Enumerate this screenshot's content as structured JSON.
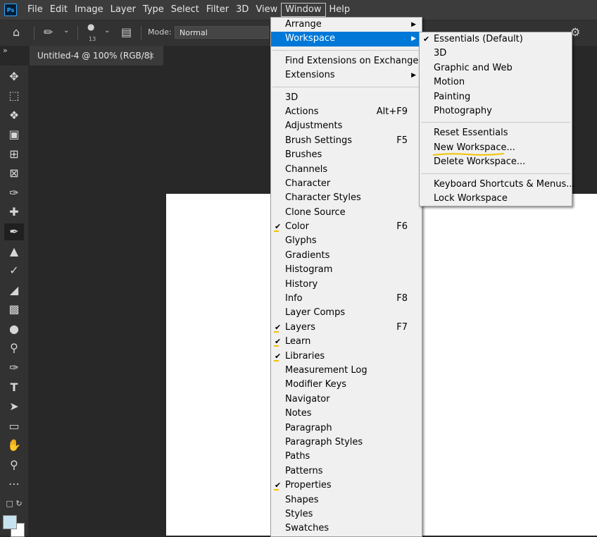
{
  "menubar": {
    "logo": "Ps",
    "items": [
      "File",
      "Edit",
      "Image",
      "Layer",
      "Type",
      "Select",
      "Filter",
      "3D",
      "View",
      "Window",
      "Help"
    ],
    "active": "Window"
  },
  "optbar": {
    "brush_size": "13",
    "mode_label": "Mode:",
    "mode_value": "Normal"
  },
  "tab": {
    "collapse_glyph": "»",
    "title": "Untitled-4 @ 100% (RGB/8)",
    "close": "×"
  },
  "colors": {
    "accent": "#0078d7",
    "menu_bg": "#f0f0f0",
    "annotation": "#f2c200",
    "foreground": "#c8e3f0",
    "background": "#ffffff"
  },
  "window_menu": {
    "items": [
      {
        "label": "Arrange",
        "submenu": true
      },
      {
        "label": "Workspace",
        "submenu": true,
        "highlighted": true
      },
      {
        "divider": true
      },
      {
        "label": "Find Extensions on Exchange..."
      },
      {
        "label": "Extensions",
        "submenu": true
      },
      {
        "divider": true
      },
      {
        "label": "3D"
      },
      {
        "label": "Actions",
        "shortcut": "Alt+F9"
      },
      {
        "label": "Adjustments"
      },
      {
        "label": "Brush Settings",
        "shortcut": "F5"
      },
      {
        "label": "Brushes"
      },
      {
        "label": "Channels"
      },
      {
        "label": "Character"
      },
      {
        "label": "Character Styles"
      },
      {
        "label": "Clone Source"
      },
      {
        "label": "Color",
        "shortcut": "F6",
        "checked": true
      },
      {
        "label": "Glyphs"
      },
      {
        "label": "Gradients"
      },
      {
        "label": "Histogram"
      },
      {
        "label": "History"
      },
      {
        "label": "Info",
        "shortcut": "F8"
      },
      {
        "label": "Layer Comps"
      },
      {
        "label": "Layers",
        "shortcut": "F7",
        "checked": true
      },
      {
        "label": "Learn",
        "checked": true
      },
      {
        "label": "Libraries",
        "checked": true
      },
      {
        "label": "Measurement Log"
      },
      {
        "label": "Modifier Keys"
      },
      {
        "label": "Navigator"
      },
      {
        "label": "Notes"
      },
      {
        "label": "Paragraph"
      },
      {
        "label": "Paragraph Styles"
      },
      {
        "label": "Paths"
      },
      {
        "label": "Patterns"
      },
      {
        "label": "Properties",
        "checked": true
      },
      {
        "label": "Shapes"
      },
      {
        "label": "Styles"
      },
      {
        "label": "Swatches"
      }
    ]
  },
  "workspace_menu": {
    "items": [
      {
        "label": "Essentials (Default)",
        "checked": true
      },
      {
        "label": "3D"
      },
      {
        "label": "Graphic and Web"
      },
      {
        "label": "Motion"
      },
      {
        "label": "Painting"
      },
      {
        "label": "Photography"
      },
      {
        "divider": true
      },
      {
        "label": "Reset Essentials"
      },
      {
        "label": "New Workspace...",
        "annotated": true
      },
      {
        "label": "Delete Workspace..."
      },
      {
        "divider": true
      },
      {
        "label": "Keyboard Shortcuts & Menus..."
      },
      {
        "label": "Lock Workspace"
      }
    ]
  },
  "tools": [
    "move-tool",
    "marquee-tool",
    "lasso-tool",
    "object-select-tool",
    "crop-tool",
    "frame-tool",
    "eyedropper-tool",
    "healing-tool",
    "brush-tool",
    "stamp-tool",
    "history-brush-tool",
    "eraser-tool",
    "gradient-tool",
    "blur-tool",
    "dodge-tool",
    "pen-tool",
    "type-tool",
    "path-select-tool",
    "rectangle-tool",
    "hand-tool",
    "zoom-tool",
    "more-tools"
  ]
}
